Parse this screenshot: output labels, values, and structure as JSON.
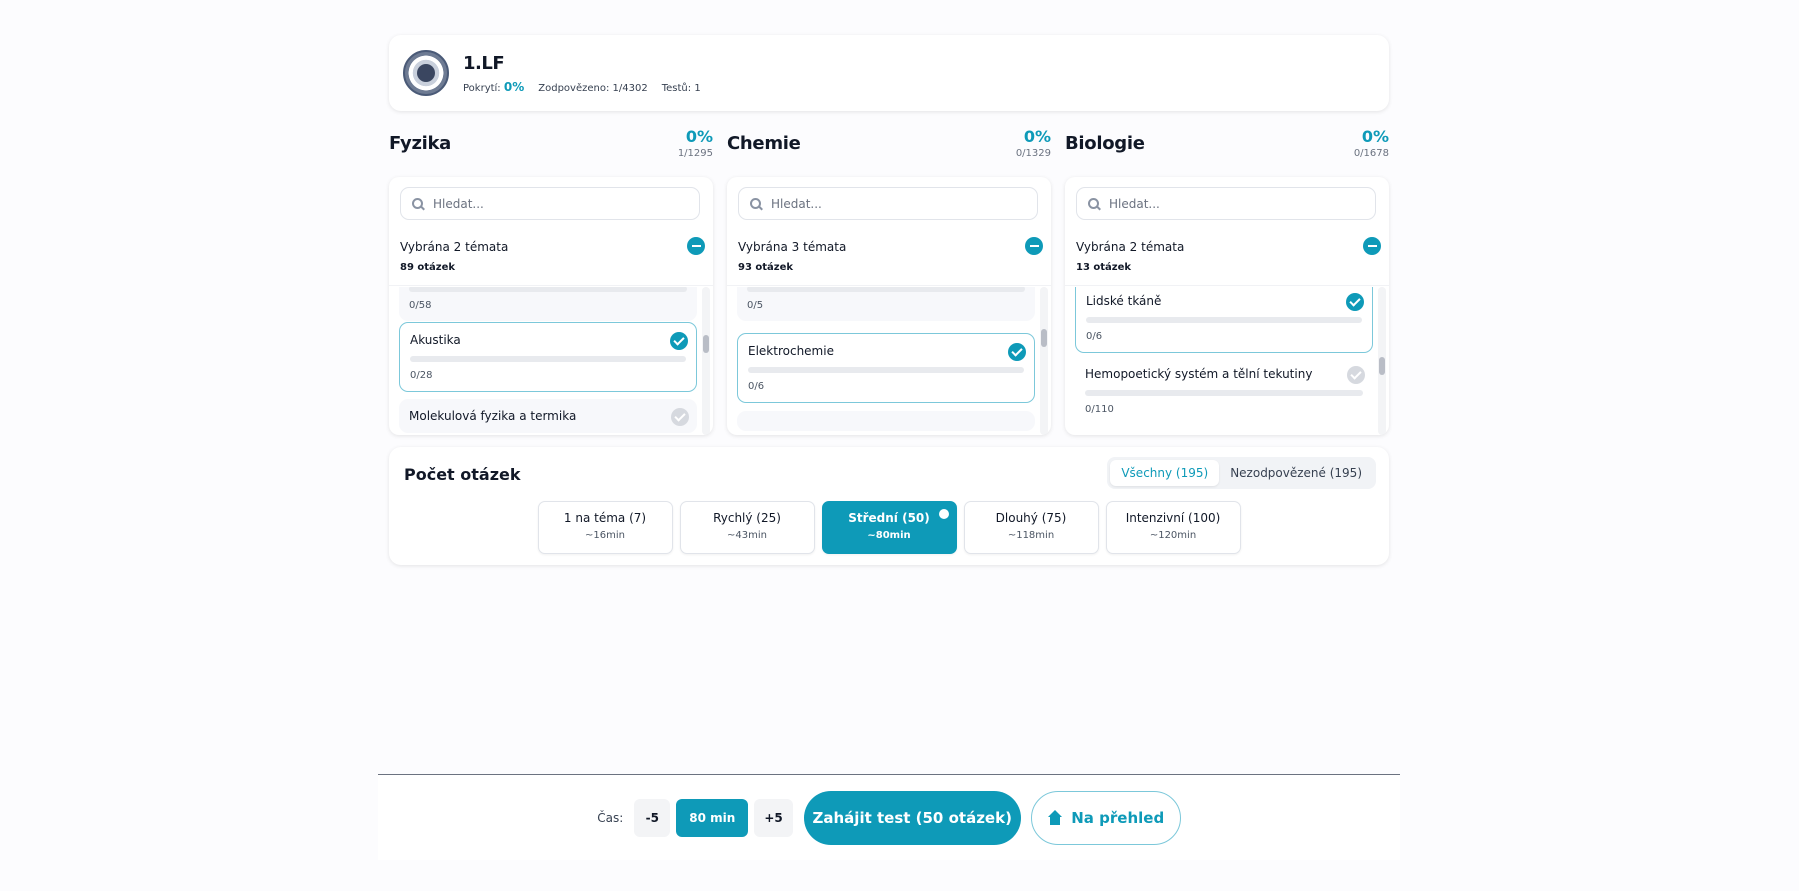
{
  "header": {
    "title": "1.LF",
    "coverage_label": "Pokrytí:",
    "coverage_value": "0%",
    "answered_label": "Zodpovězeno:",
    "answered_value": "1/4302",
    "tests_label": "Testů:",
    "tests_value": "1"
  },
  "subjects": [
    {
      "title": "Fyzika",
      "percent": "0%",
      "count": "1/1295",
      "search_placeholder": "Hledat...",
      "selected_label": "Vybrána 2 témata",
      "selected_count": "89 otázek",
      "topics": [
        {
          "name": "",
          "count": "0/58",
          "selected": false
        },
        {
          "name": "Akustika",
          "count": "0/28",
          "selected": true
        },
        {
          "name": "Molekulová fyzika a termika",
          "count": "",
          "selected": false
        }
      ]
    },
    {
      "title": "Chemie",
      "percent": "0%",
      "count": "0/1329",
      "search_placeholder": "Hledat...",
      "selected_label": "Vybrána 3 témata",
      "selected_count": "93 otázek",
      "topics": [
        {
          "name": "",
          "count": "0/5",
          "selected": false
        },
        {
          "name": "Elektrochemie",
          "count": "0/6",
          "selected": true
        }
      ]
    },
    {
      "title": "Biologie",
      "percent": "0%",
      "count": "0/1678",
      "search_placeholder": "Hledat...",
      "selected_label": "Vybrána 2 témata",
      "selected_count": "13 otázek",
      "topics": [
        {
          "name": "Lidské tkáně",
          "count": "0/6",
          "selected": true
        },
        {
          "name": "Hemopoetický systém a tělní tekutiny",
          "count": "0/110",
          "selected": false
        }
      ]
    }
  ],
  "questions": {
    "title": "Počet otázek",
    "filter_all": "Všechny (195)",
    "filter_unanswered": "Nezodpovězené (195)",
    "options": [
      {
        "name": "1 na téma (7)",
        "time": "~16min",
        "active": false
      },
      {
        "name": "Rychlý (25)",
        "time": "~43min",
        "active": false
      },
      {
        "name": "Střední (50)",
        "time": "~80min",
        "active": true
      },
      {
        "name": "Dlouhý (75)",
        "time": "~118min",
        "active": false
      },
      {
        "name": "Intenzivní (100)",
        "time": "~120min",
        "active": false
      }
    ]
  },
  "footer": {
    "time_label": "Čas:",
    "minus": "-5",
    "time_value": "80 min",
    "plus": "+5",
    "start": "Zahájit test (50 otázek)",
    "home": "Na přehled"
  },
  "colors": {
    "accent": "#0e9ab8"
  }
}
